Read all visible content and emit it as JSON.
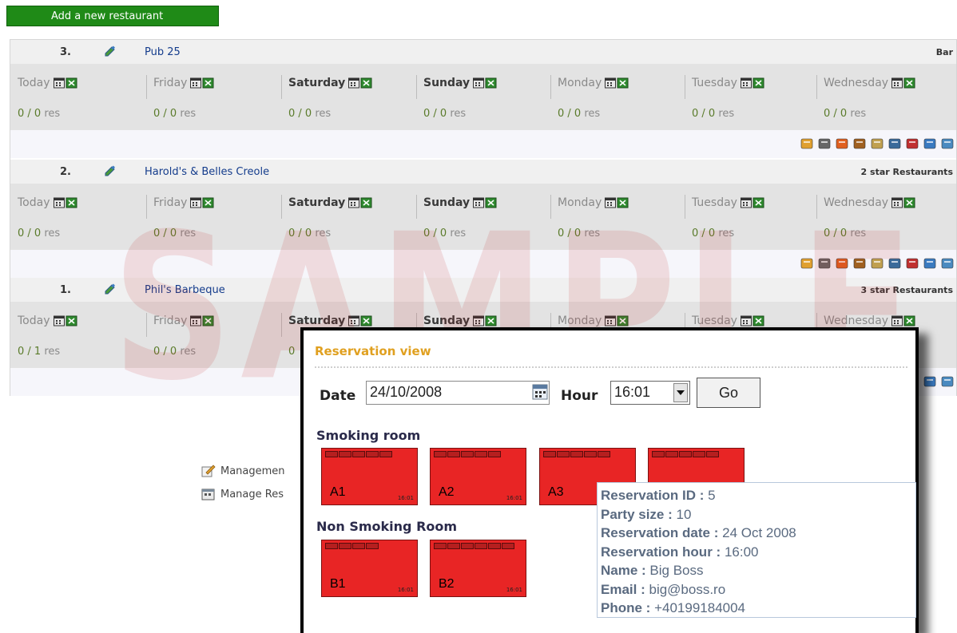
{
  "toolbar": {
    "add_label": "Add a new restaurant"
  },
  "restaurants": [
    {
      "rank": "3.",
      "name": "Pub 25",
      "type": "Bar",
      "days": [
        {
          "label": "Today",
          "count": "0 / 0",
          "unit": "res"
        },
        {
          "label": "Friday",
          "count": "0 / 0",
          "unit": "res"
        },
        {
          "label": "Saturday",
          "count": "0 / 0",
          "unit": "res"
        },
        {
          "label": "Sunday",
          "count": "0 / 0",
          "unit": "res"
        },
        {
          "label": "Monday",
          "count": "0 / 0",
          "unit": "res"
        },
        {
          "label": "Tuesday",
          "count": "0 / 0",
          "unit": "res"
        },
        {
          "label": "Wednesday",
          "count": "0 / 0",
          "unit": "res"
        }
      ]
    },
    {
      "rank": "2.",
      "name": "Harold's & Belles Creole",
      "type": "2 star Restaurants",
      "days": [
        {
          "label": "Today",
          "count": "0 / 0",
          "unit": "res"
        },
        {
          "label": "Friday",
          "count": "0 / 0",
          "unit": "res"
        },
        {
          "label": "Saturday",
          "count": "0 / 0",
          "unit": "res"
        },
        {
          "label": "Sunday",
          "count": "0 / 0",
          "unit": "res"
        },
        {
          "label": "Monday",
          "count": "0 / 0",
          "unit": "res"
        },
        {
          "label": "Tuesday",
          "count": "0 / 0",
          "unit": "res"
        },
        {
          "label": "Wednesday",
          "count": "0 / 0",
          "unit": "res"
        }
      ]
    },
    {
      "rank": "1.",
      "name": "Phil's Barbeque",
      "type": "3 star Restaurants",
      "days": [
        {
          "label": "Today",
          "count": "0 / 1",
          "unit": "res"
        },
        {
          "label": "Friday",
          "count": "0 / 0",
          "unit": "res"
        },
        {
          "label": "Saturday",
          "count": "0",
          "unit": ""
        },
        {
          "label": "Sunday",
          "count": "",
          "unit": ""
        },
        {
          "label": "Monday",
          "count": "",
          "unit": ""
        },
        {
          "label": "Tuesday",
          "count": "",
          "unit": ""
        },
        {
          "label": "Wednesday",
          "count": "",
          "unit": ""
        }
      ]
    }
  ],
  "footer": {
    "link1": "Managemen",
    "link2": "Manage Res"
  },
  "watermark": "SAMPLE IMAGE",
  "popup": {
    "title": "Reservation view",
    "date_label": "Date",
    "date_value": "24/10/2008",
    "hour_label": "Hour",
    "hour_value": "16:01",
    "go_label": "Go",
    "smoking_title": "Smoking room",
    "non_smoking_title": "Non Smoking Room",
    "smoking_tables": [
      {
        "name": "A1",
        "time": "16:01"
      },
      {
        "name": "A2",
        "time": "16:01"
      },
      {
        "name": "A3",
        "time": ""
      },
      {
        "name": "",
        "time": ""
      }
    ],
    "non_smoking_tables": [
      {
        "name": "B1",
        "time": "16:01"
      },
      {
        "name": "B2",
        "time": "16:01"
      }
    ],
    "tooltip": {
      "id_label": "Reservation ID :",
      "id_value": "5",
      "party_label": "Party size :",
      "party_value": "10",
      "date_label": "Reservation date :",
      "date_value": "24 Oct 2008",
      "hour_label": "Reservation hour :",
      "hour_value": "16:00",
      "name_label": "Name :",
      "name_value": "Big Boss",
      "email_label": "Email :",
      "email_value": "big@boss.ro",
      "phone_label": "Phone :",
      "phone_value": "+40199184004"
    }
  }
}
